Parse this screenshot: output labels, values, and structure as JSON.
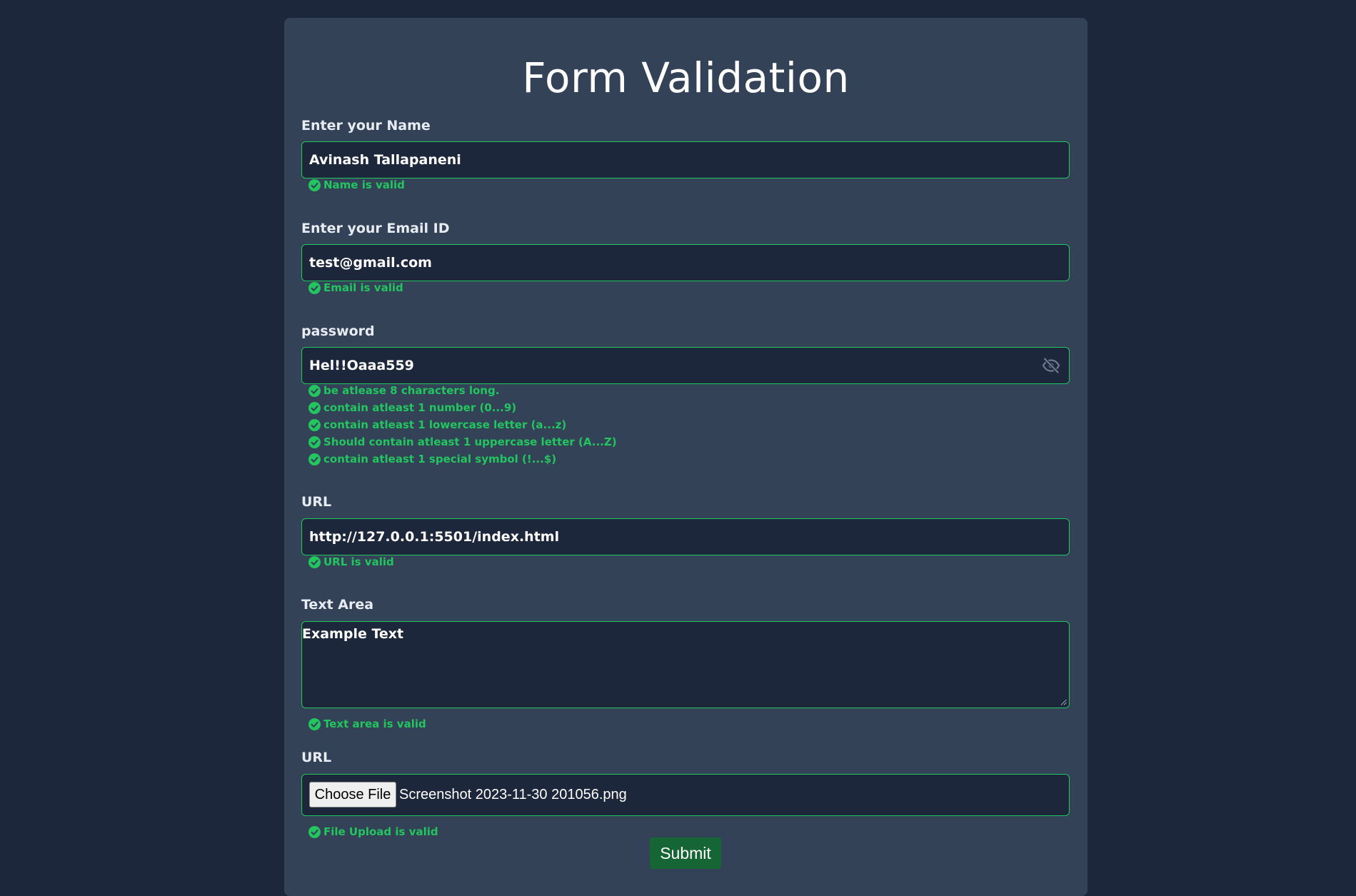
{
  "form": {
    "title": "Form Validation",
    "name": {
      "label": "Enter your Name",
      "value": "Avinash Tallapaneni",
      "message": "Name is valid"
    },
    "email": {
      "label": "Enter your Email ID",
      "value": "test@gmail.com",
      "message": "Email is valid"
    },
    "password": {
      "label": "password",
      "value": "Hel!!Oaaa559",
      "toggle_icon": "eye-slash-icon",
      "rules": [
        "be atlease 8 characters long.",
        "contain atleast 1 number (0...9)",
        "contain atleast 1 lowercase letter (a...z)",
        "Should contain atleast 1 uppercase letter (A...Z)",
        "contain atleast 1 special symbol (!...$)"
      ]
    },
    "url": {
      "label": "URL",
      "value": "http://127.0.0.1:5501/index.html",
      "message": "URL is valid"
    },
    "textarea": {
      "label": "Text Area",
      "value": "Example Text",
      "message": "Text area is valid"
    },
    "file": {
      "label": "URL",
      "button_label": "Choose File",
      "file_name": "Screenshot 2023-11-30 201056.png",
      "message": "File Upload is valid"
    },
    "submit_label": "Submit"
  },
  "colors": {
    "page_background": "#1d273b",
    "card_background": "#334257",
    "valid": "#22c55e",
    "submit": "#166534"
  }
}
